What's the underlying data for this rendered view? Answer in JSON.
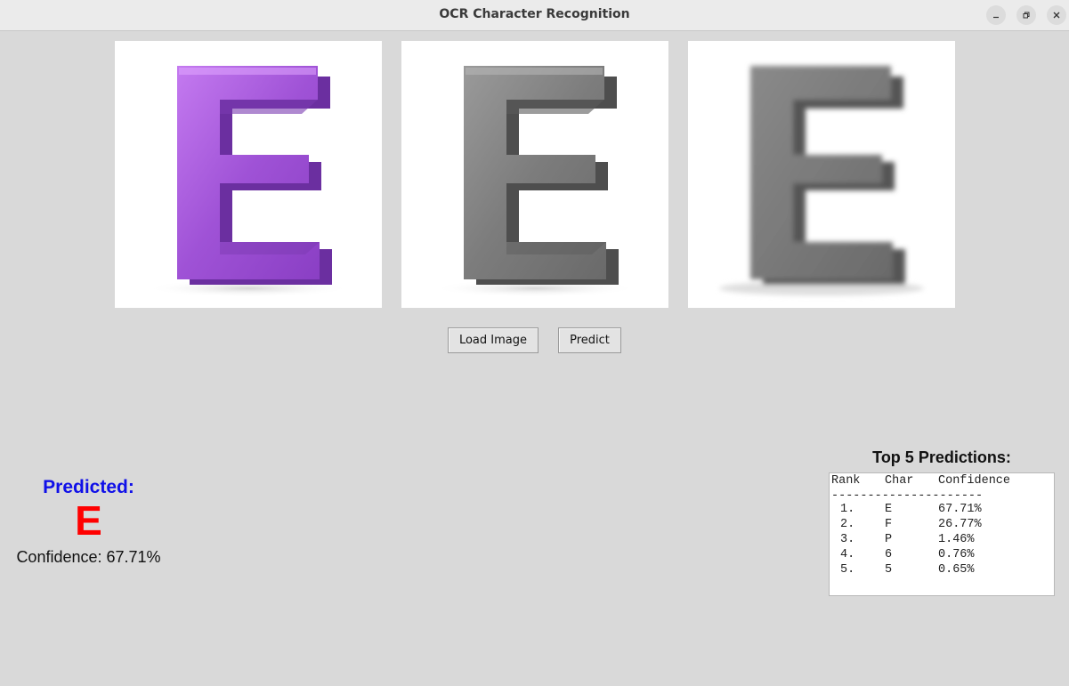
{
  "window": {
    "title": "OCR Character Recognition",
    "controls": [
      "minimize-icon",
      "restore-icon",
      "close-icon"
    ]
  },
  "image_panels": [
    {
      "name": "original",
      "letter": "E",
      "color": "#a155d8"
    },
    {
      "name": "grayscale",
      "letter": "E",
      "color": "#7a7a7a"
    },
    {
      "name": "blurred",
      "letter": "E",
      "color": "#6f6f6f"
    }
  ],
  "buttons": {
    "load_label": "Load Image",
    "predict_label": "Predict"
  },
  "prediction": {
    "heading": "Predicted:",
    "character": "E",
    "confidence_text": "Confidence: 67.71%",
    "heading_color": "#1010e8",
    "char_color": "#ff0000"
  },
  "top5": {
    "heading": "Top 5 Predictions:",
    "columns": [
      "Rank",
      "Char",
      "Confidence"
    ],
    "rule": "---------------------",
    "rows": [
      {
        "rank": "1.",
        "char": "E",
        "confidence": "67.71%"
      },
      {
        "rank": "2.",
        "char": "F",
        "confidence": "26.77%"
      },
      {
        "rank": "3.",
        "char": "P",
        "confidence": "1.46%"
      },
      {
        "rank": "4.",
        "char": "6",
        "confidence": "0.76%"
      },
      {
        "rank": "5.",
        "char": "5",
        "confidence": "0.65%"
      }
    ]
  }
}
